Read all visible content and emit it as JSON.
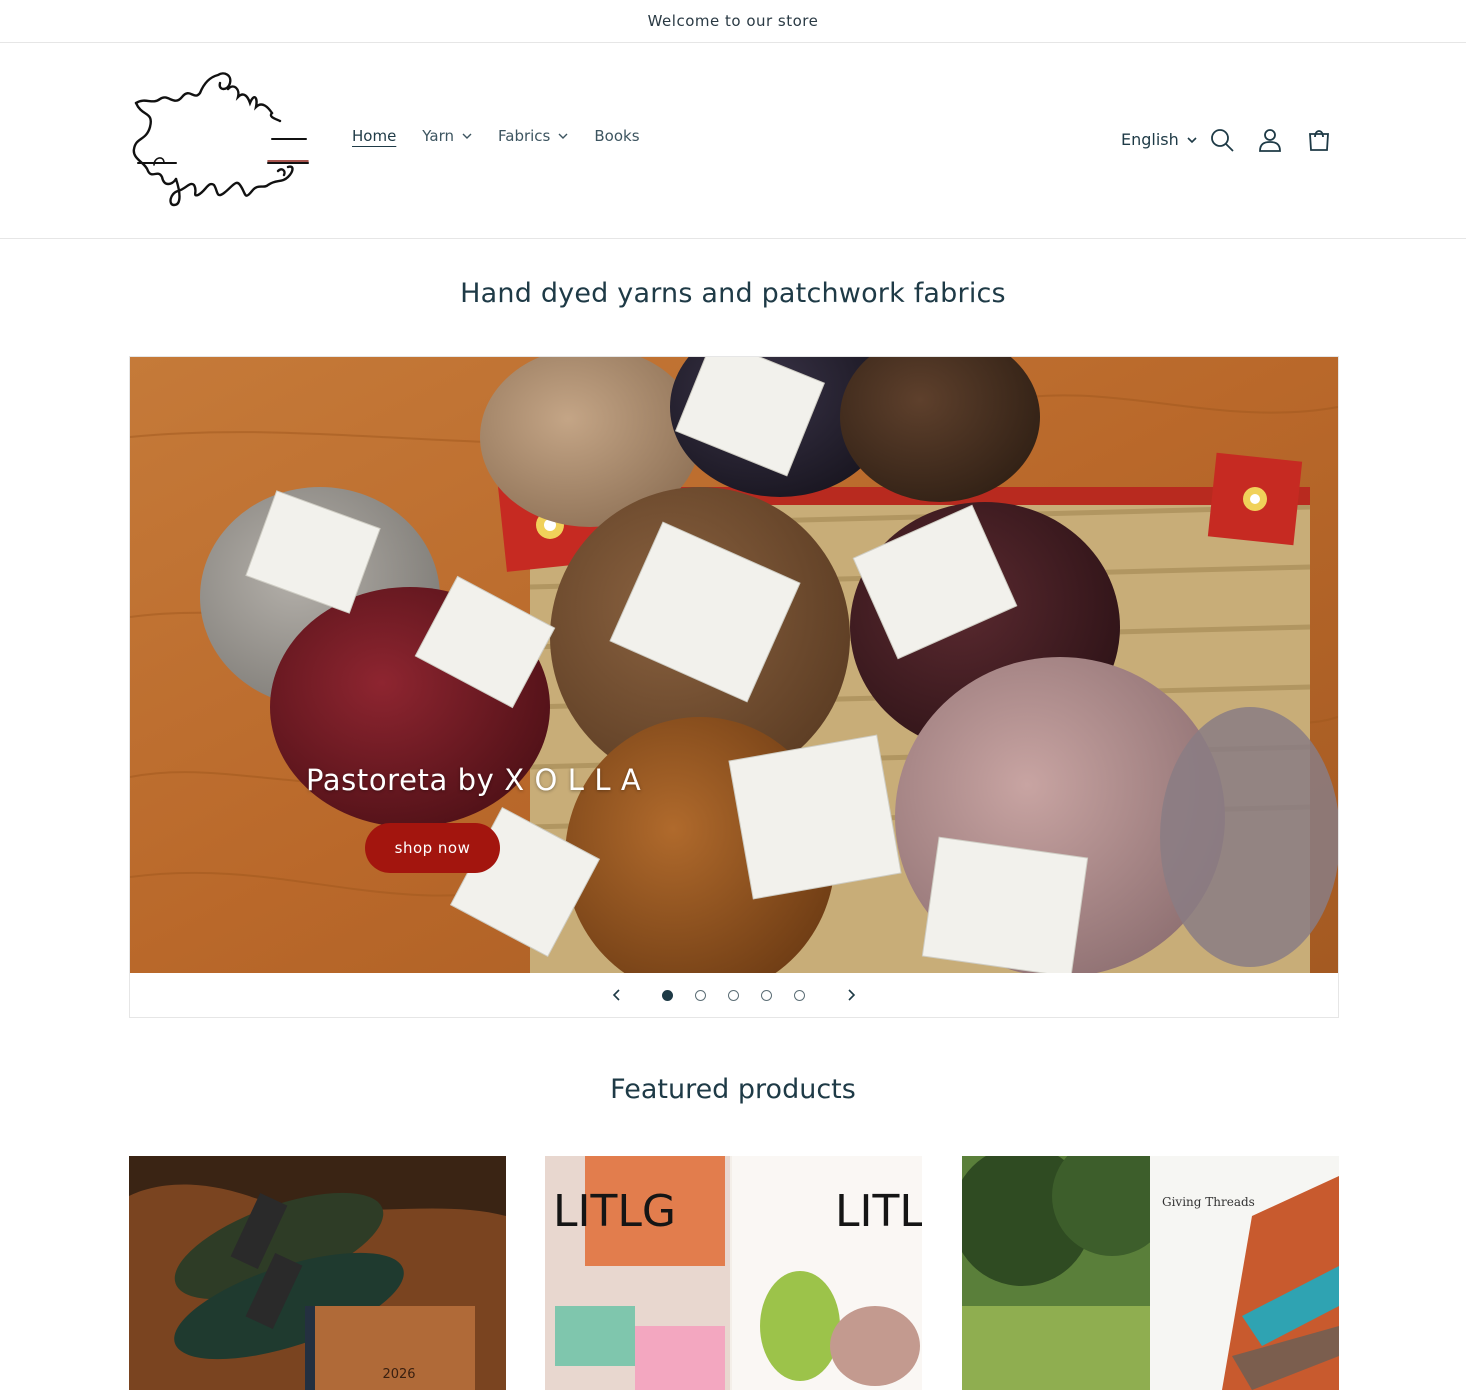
{
  "announcement": "Welcome to our store",
  "header": {
    "logo_alt": "Punta",
    "nav": [
      {
        "label": "Home",
        "dropdown": false,
        "active": true
      },
      {
        "label": "Yarn",
        "dropdown": true,
        "active": false
      },
      {
        "label": "Fabrics",
        "dropdown": true,
        "active": false
      },
      {
        "label": "Books",
        "dropdown": false,
        "active": false
      }
    ],
    "language": "English",
    "icons": [
      "search-icon",
      "account-icon",
      "cart-icon"
    ]
  },
  "headline": "Hand dyed yarns and patchwork fabrics",
  "slideshow": {
    "slide_title": "Pastoreta by X O L L A",
    "button_label": "shop now",
    "slide_count": 5,
    "active_slide": 1
  },
  "featured": {
    "title": "Featured products",
    "cards": [
      {
        "image": "yarn-skeins-and-2026-planner",
        "visible_text": "2026"
      },
      {
        "image": "litlg-magazine-socks",
        "visible_text": "LITLG"
      },
      {
        "image": "giving-threads-pattern-book",
        "visible_text": "Giving Threads"
      }
    ]
  },
  "colors": {
    "text": "#1e3a46",
    "button": "#a3150e",
    "border": "#e6e6e6"
  }
}
